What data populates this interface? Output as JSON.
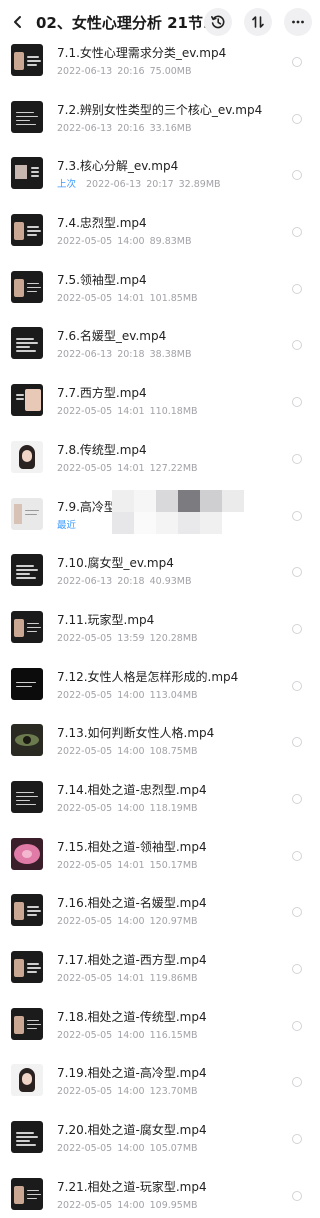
{
  "header": {
    "title": "02、女性心理分析 21节...",
    "back_icon": "chevron-left-icon",
    "history_icon": "history-icon",
    "sort_icon": "sort-icon",
    "more_icon": "more-icon"
  },
  "colors": {
    "recent_tag": "#3d9bff",
    "meta_text": "#a2a2a8"
  },
  "files": [
    {
      "name": "7.1.女性心理需求分类_ev.mp4",
      "tag": "",
      "date": "2022-06-13",
      "time": "20:16",
      "size": "75.00MB"
    },
    {
      "name": "7.2.辨别女性类型的三个核心_ev.mp4",
      "tag": "",
      "date": "2022-06-13",
      "time": "20:16",
      "size": "33.16MB"
    },
    {
      "name": "7.3.核心分解_ev.mp4",
      "tag": "上次",
      "date": "2022-06-13",
      "time": "20:17",
      "size": "32.89MB"
    },
    {
      "name": "7.4.忠烈型.mp4",
      "tag": "",
      "date": "2022-05-05",
      "time": "14:00",
      "size": "89.83MB"
    },
    {
      "name": "7.5.领袖型.mp4",
      "tag": "",
      "date": "2022-05-05",
      "time": "14:01",
      "size": "101.85MB"
    },
    {
      "name": "7.6.名媛型_ev.mp4",
      "tag": "",
      "date": "2022-06-13",
      "time": "20:18",
      "size": "38.38MB"
    },
    {
      "name": "7.7.西方型.mp4",
      "tag": "",
      "date": "2022-05-05",
      "time": "14:01",
      "size": "110.18MB"
    },
    {
      "name": "7.8.传统型.mp4",
      "tag": "",
      "date": "2022-05-05",
      "time": "14:01",
      "size": "127.22MB"
    },
    {
      "name": "7.9.高冷型",
      "tag": "最近",
      "date": "",
      "time": "",
      "size": ""
    },
    {
      "name": "7.10.腐女型_ev.mp4",
      "tag": "",
      "date": "2022-06-13",
      "time": "20:18",
      "size": "40.93MB"
    },
    {
      "name": "7.11.玩家型.mp4",
      "tag": "",
      "date": "2022-05-05",
      "time": "13:59",
      "size": "120.28MB"
    },
    {
      "name": "7.12.女性人格是怎样形成的.mp4",
      "tag": "",
      "date": "2022-05-05",
      "time": "14:00",
      "size": "113.04MB"
    },
    {
      "name": "7.13.如何判断女性人格.mp4",
      "tag": "",
      "date": "2022-05-05",
      "time": "14:00",
      "size": "108.75MB"
    },
    {
      "name": "7.14.相处之道-忠烈型.mp4",
      "tag": "",
      "date": "2022-05-05",
      "time": "14:00",
      "size": "118.19MB"
    },
    {
      "name": "7.15.相处之道-领袖型.mp4",
      "tag": "",
      "date": "2022-05-05",
      "time": "14:01",
      "size": "150.17MB"
    },
    {
      "name": "7.16.相处之道-名媛型.mp4",
      "tag": "",
      "date": "2022-05-05",
      "time": "14:00",
      "size": "120.97MB"
    },
    {
      "name": "7.17.相处之道-西方型.mp4",
      "tag": "",
      "date": "2022-05-05",
      "time": "14:01",
      "size": "119.86MB"
    },
    {
      "name": "7.18.相处之道-传统型.mp4",
      "tag": "",
      "date": "2022-05-05",
      "time": "14:00",
      "size": "116.15MB"
    },
    {
      "name": "7.19.相处之道-高冷型.mp4",
      "tag": "",
      "date": "2022-05-05",
      "time": "14:00",
      "size": "123.70MB"
    },
    {
      "name": "7.20.相处之道-腐女型.mp4",
      "tag": "",
      "date": "2022-05-05",
      "time": "14:00",
      "size": "105.07MB"
    },
    {
      "name": "7.21.相处之道-玩家型.mp4",
      "tag": "",
      "date": "2022-05-05",
      "time": "14:00",
      "size": "109.95MB"
    }
  ]
}
